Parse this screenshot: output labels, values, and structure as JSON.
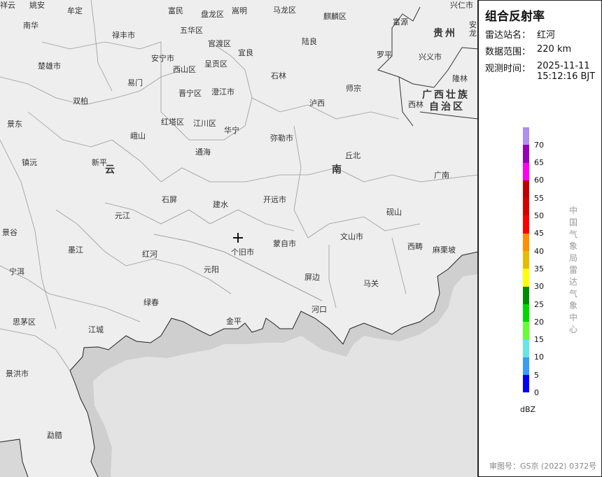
{
  "panel": {
    "title": "组合反射率",
    "station_label": "雷达站名：",
    "station_value": "红河",
    "range_label": "数据范围：",
    "range_value": "220 km",
    "time_label": "观测时间：",
    "time_date": "2025-11-11",
    "time_clock": "15:12:16 BJT",
    "legend_unit": "dBZ",
    "legend_ticks": [
      "0",
      "5",
      "10",
      "15",
      "20",
      "25",
      "30",
      "35",
      "40",
      "45",
      "50",
      "55",
      "60",
      "65",
      "70"
    ],
    "legend_colors": [
      "#0000f6",
      "#3c9cf0",
      "#66e6e6",
      "#66ff33",
      "#00d800",
      "#008c00",
      "#ffff00",
      "#e6bc00",
      "#ff9000",
      "#ff0000",
      "#d60000",
      "#c00000",
      "#ff00f0",
      "#9600b4",
      "#ae90ee"
    ],
    "agency": "中国气象局雷达气象中心",
    "map_approval": "审图号：GS京 (2022) 0372号"
  },
  "map": {
    "radar_marker_icon": "crosshair-icon",
    "provinces": [
      "贵州",
      "广西壮族",
      "自治区",
      "云",
      "南"
    ],
    "places": [
      "祥云",
      "姚安",
      "牟定",
      "南华",
      "禄丰市",
      "富民",
      "盘龙区",
      "嵩明",
      "马龙区",
      "麒麟区",
      "富源",
      "兴仁市",
      "安龙",
      "五华区",
      "官渡区",
      "宜良",
      "陆良",
      "罗平",
      "兴义市",
      "安宁市",
      "西山区",
      "呈贡区",
      "楚雄市",
      "石林",
      "隆林",
      "易门",
      "晋宁区",
      "澄江市",
      "师宗",
      "西林",
      "双柏",
      "泸西",
      "景东",
      "红塔区",
      "江川区",
      "华宁",
      "峨山",
      "弥勒市",
      "通海",
      "丘北",
      "镇沅",
      "新平",
      "广南",
      "石屏",
      "建水",
      "开远市",
      "砚山",
      "元江",
      "景谷",
      "文山市",
      "墨江",
      "红河",
      "蒙自市",
      "个旧市",
      "西畴",
      "麻栗坡",
      "宁洱",
      "元阳",
      "屏边",
      "马关",
      "绿春",
      "河口",
      "思茅区",
      "金平",
      "江城",
      "景洪市",
      "勐腊"
    ]
  }
}
